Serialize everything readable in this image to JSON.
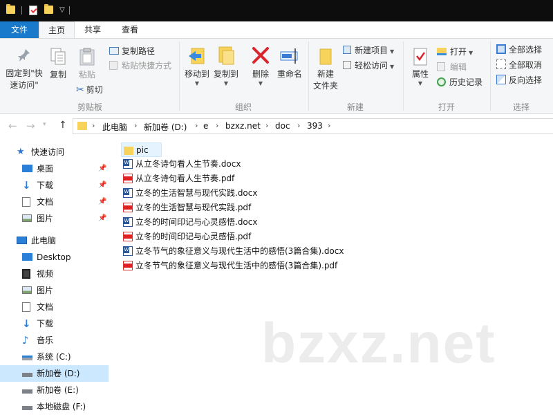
{
  "ribbon_tabs": [
    "文件",
    "主页",
    "共享",
    "查看"
  ],
  "clipboard": {
    "pin_label_1": "固定到\"快",
    "pin_label_2": "速访问\"",
    "copy": "复制",
    "paste": "粘贴",
    "copy_path": "复制路径",
    "paste_shortcut": "粘贴快捷方式",
    "cut": "剪切",
    "group": "剪贴板"
  },
  "organize": {
    "move_to": "移动到",
    "copy_to": "复制到",
    "delete": "删除",
    "rename": "重命名",
    "group": "组织"
  },
  "new_group": {
    "new_folder_1": "新建",
    "new_folder_2": "文件夹",
    "new_item": "新建项目",
    "easy_access": "轻松访问",
    "group": "新建"
  },
  "open_group": {
    "properties": "属性",
    "open": "打开",
    "edit": "编辑",
    "history": "历史记录",
    "group": "打开"
  },
  "select_group": {
    "select_all": "全部选择",
    "select_none": "全部取消",
    "invert": "反向选择",
    "group": "选择"
  },
  "breadcrumbs": [
    "此电脑",
    "新加卷 (D:)",
    "e",
    "bzxz.net",
    "doc",
    "393"
  ],
  "nav": {
    "quick_access": "快速访问",
    "qa_items": [
      "桌面",
      "下载",
      "文档",
      "图片"
    ],
    "this_pc": "此电脑",
    "pc_items": [
      "Desktop",
      "视频",
      "图片",
      "文档",
      "下载",
      "音乐",
      "系统 (C:)",
      "新加卷 (D:)",
      "新加卷 (E:)",
      "本地磁盘 (F:)"
    ]
  },
  "files": [
    {
      "name": "pic",
      "type": "folder"
    },
    {
      "name": "从立冬诗句看人生节奏.docx",
      "type": "docx"
    },
    {
      "name": "从立冬诗句看人生节奏.pdf",
      "type": "pdf"
    },
    {
      "name": "立冬的生活智慧与现代实践.docx",
      "type": "docx"
    },
    {
      "name": "立冬的生活智慧与现代实践.pdf",
      "type": "pdf"
    },
    {
      "name": "立冬的时间印记与心灵感悟.docx",
      "type": "docx"
    },
    {
      "name": "立冬的时间印记与心灵感悟.pdf",
      "type": "pdf"
    },
    {
      "name": "立冬节气的象征意义与现代生活中的感悟(3篇合集).docx",
      "type": "docx"
    },
    {
      "name": "立冬节气的象征意义与现代生活中的感悟(3篇合集).pdf",
      "type": "pdf"
    }
  ],
  "watermark": "bzxz.net",
  "colors": {
    "accent": "#1979ca",
    "selection": "#cce8ff",
    "folder": "#f7d35b",
    "pdf": "#e02020",
    "word": "#2b5797"
  }
}
